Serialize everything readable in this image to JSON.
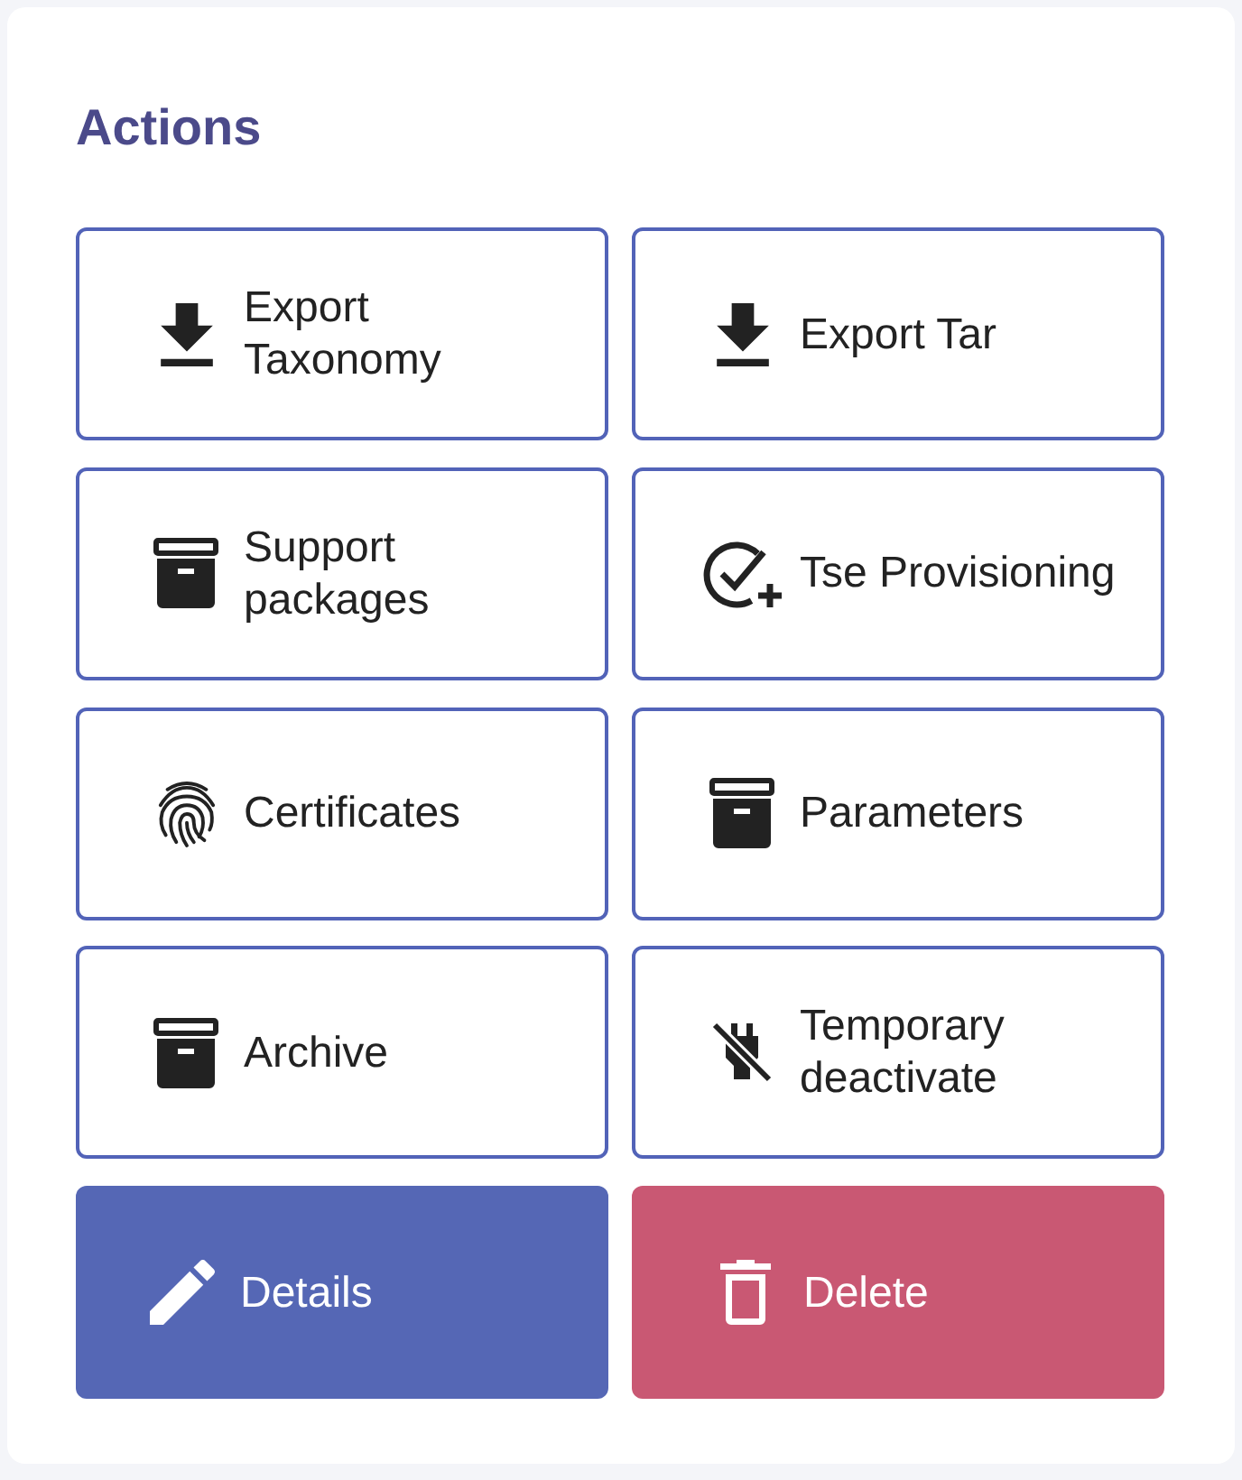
{
  "card": {
    "title": "Actions"
  },
  "actions": [
    {
      "label": "Export Taxonomy",
      "kind": "outline"
    },
    {
      "label": "Export Tar",
      "kind": "outline"
    },
    {
      "label": "Support packages",
      "kind": "outline"
    },
    {
      "label": "Tse Provisioning",
      "kind": "outline"
    },
    {
      "label": "Certificates",
      "kind": "outline"
    },
    {
      "label": "Parameters",
      "kind": "outline"
    },
    {
      "label": "Archive",
      "kind": "outline"
    },
    {
      "label": "Temporary deactivate",
      "kind": "outline"
    },
    {
      "label": "Details",
      "kind": "primary"
    },
    {
      "label": "Delete",
      "kind": "danger"
    }
  ]
}
